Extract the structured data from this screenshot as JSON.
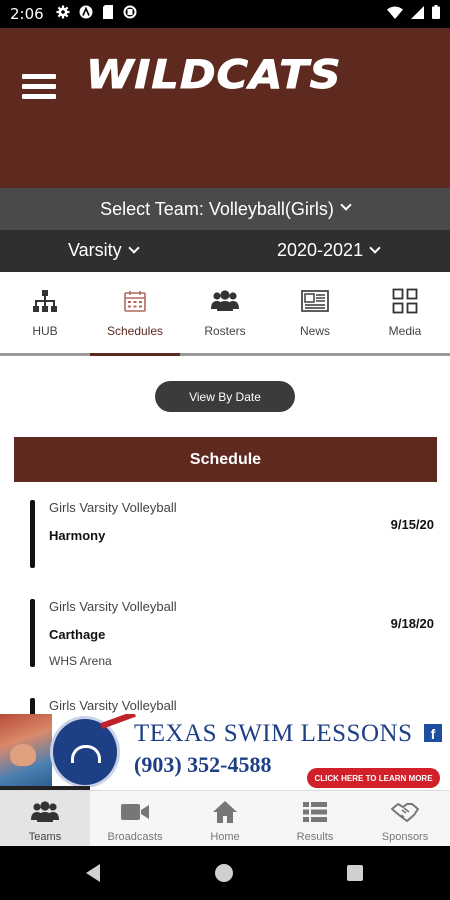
{
  "status_bar": {
    "time": "2:06"
  },
  "header": {
    "logo_text": "WILDCATS"
  },
  "team_selector": {
    "label": "Select Team:",
    "value": "Volleyball(Girls)"
  },
  "filters": {
    "level": "Varsity",
    "season": "2020-2021"
  },
  "tabs": [
    {
      "label": "HUB",
      "icon": "hierarchy-icon"
    },
    {
      "label": "Schedules",
      "icon": "calendar-icon",
      "active": true
    },
    {
      "label": "Rosters",
      "icon": "people-icon"
    },
    {
      "label": "News",
      "icon": "newspaper-icon"
    },
    {
      "label": "Media",
      "icon": "grid-icon"
    }
  ],
  "view_toggle": {
    "label": "View By Date"
  },
  "schedule": {
    "title": "Schedule",
    "games": [
      {
        "sport": "Girls Varsity Volleyball",
        "opponent": "Harmony",
        "date": "9/15/20",
        "venue": ""
      },
      {
        "sport": "Girls Varsity Volleyball",
        "opponent": "Carthage",
        "date": "9/18/20",
        "venue": "WHS Arena"
      },
      {
        "sport": "Girls Varsity Volleyball",
        "opponent": "",
        "date": "",
        "venue": ""
      }
    ]
  },
  "ad": {
    "title": "TEXAS SWIM LESSONS",
    "phone": "(903) 352-4588",
    "cta": "CLICK HERE TO LEARN MORE"
  },
  "bottom_nav": [
    {
      "label": "Teams",
      "icon": "people-icon",
      "active": true
    },
    {
      "label": "Broadcasts",
      "icon": "video-camera-icon"
    },
    {
      "label": "Home",
      "icon": "home-icon"
    },
    {
      "label": "Results",
      "icon": "list-icon"
    },
    {
      "label": "Sponsors",
      "icon": "handshake-icon"
    }
  ],
  "colors": {
    "brand": "#5e2a1f",
    "dark_gray": "#4a4a4a",
    "darker_gray": "#2f2f2f",
    "ad_blue": "#1d3f86",
    "ad_red": "#d1202a"
  }
}
